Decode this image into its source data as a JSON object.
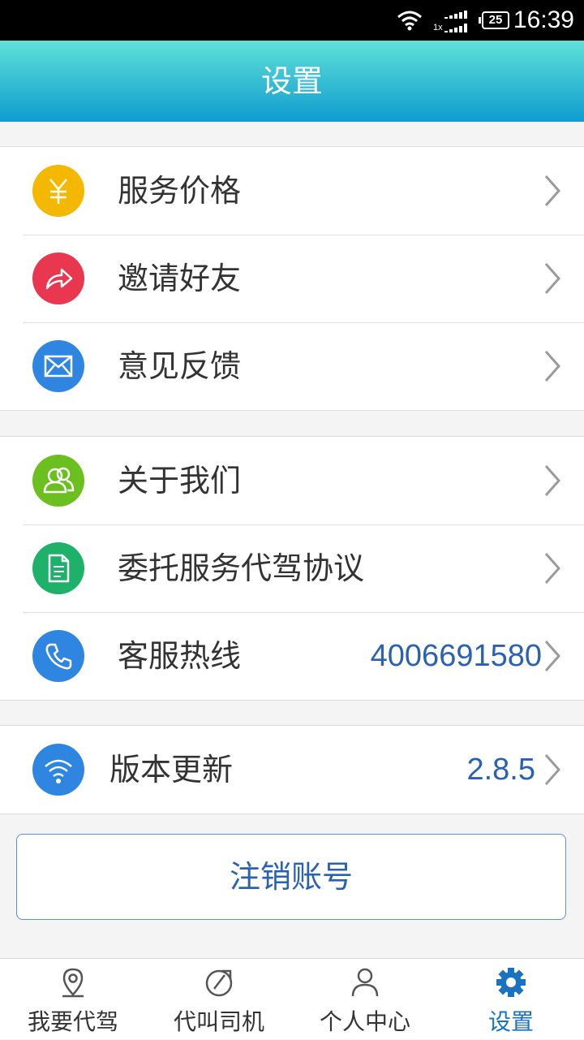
{
  "status_bar": {
    "network": "1x",
    "battery": "25",
    "time": "16:39"
  },
  "header": {
    "title": "设置"
  },
  "group1": [
    {
      "label": "服务价格",
      "icon": "yuan-icon",
      "color": "#f5b800"
    },
    {
      "label": "邀请好友",
      "icon": "share-icon",
      "color": "#e8374f"
    },
    {
      "label": "意见反馈",
      "icon": "mail-icon",
      "color": "#2f86e0"
    }
  ],
  "group2": [
    {
      "label": "关于我们",
      "icon": "people-icon",
      "color": "#6bbf1e"
    },
    {
      "label": "委托服务代驾协议",
      "icon": "document-icon",
      "color": "#1db169"
    },
    {
      "label": "客服热线",
      "icon": "phone-icon",
      "color": "#2f86e0",
      "value": "4006691580"
    }
  ],
  "group3": [
    {
      "label": "版本更新",
      "icon": "wifi-icon",
      "color": "#2f86e0",
      "value": "2.8.5"
    }
  ],
  "logout_label": "注销账号",
  "tabs": [
    {
      "label": "我要代驾",
      "icon": "location-icon"
    },
    {
      "label": "代叫司机",
      "icon": "compass-icon"
    },
    {
      "label": "个人中心",
      "icon": "person-icon"
    },
    {
      "label": "设置",
      "icon": "gear-icon",
      "active": true
    }
  ],
  "colors": {
    "accent": "#2a62b0",
    "tab_active": "#1a73c0"
  }
}
